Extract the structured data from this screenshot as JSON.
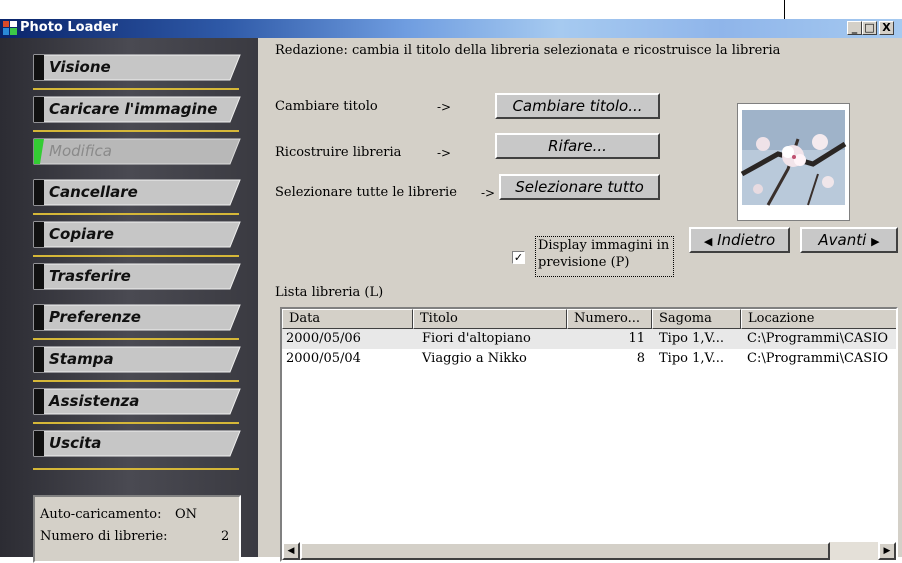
{
  "window": {
    "title": "Photo Loader"
  },
  "titlebar_buttons": {
    "minimize": "_",
    "maximize": "□",
    "close": "X"
  },
  "sidebar": {
    "items": [
      {
        "label": "Visione",
        "enabled": true
      },
      {
        "label": "Caricare l'immagine",
        "enabled": true
      },
      {
        "label": "Modifica",
        "enabled": false,
        "active": true
      },
      {
        "label": "Cancellare",
        "enabled": true
      },
      {
        "label": "Copiare",
        "enabled": true
      },
      {
        "label": "Trasferire",
        "enabled": true
      },
      {
        "label": "Preferenze",
        "enabled": true
      },
      {
        "label": "Stampa",
        "enabled": true
      },
      {
        "label": "Assistenza",
        "enabled": true
      },
      {
        "label": "Uscita",
        "enabled": true
      }
    ],
    "status": {
      "autoload_label": "Auto-caricamento:",
      "autoload_value": "ON",
      "count_label": "Numero di librerie:",
      "count_value": "2"
    }
  },
  "main": {
    "description": "Redazione: cambia il titolo della libreria selezionata e ricostruisce la libreria",
    "actions": [
      {
        "label": "Cambiare titolo",
        "arrow": "->",
        "button": "Cambiare titolo..."
      },
      {
        "label": "Ricostruire libreria",
        "arrow": "->",
        "button": "Rifare..."
      },
      {
        "label": "Selezionare tutte le librerie",
        "arrow": "->",
        "button": "Selezionare tutto"
      }
    ],
    "preview_checkbox": {
      "label": "Display immagini in previsione (P)",
      "checked": true
    },
    "nav": {
      "back": "Indietro",
      "forward": "Avanti"
    },
    "list_label": "Lista libreria (L)",
    "columns": [
      "Data",
      "Titolo",
      "Numero...",
      "Sagoma",
      "Locazione"
    ],
    "rows": [
      [
        "2000/05/06",
        "Fiori d'altopiano",
        "11",
        "Tipo 1,V...",
        "C:\\Programmi\\CASIO"
      ],
      [
        "2000/05/04",
        "Viaggio a Nikko",
        "8",
        "Tipo 1,V...",
        "C:\\Programmi\\CASIO"
      ]
    ]
  },
  "colors": {
    "accent_divider": "#d5b738",
    "active_indicator": "#33cc33",
    "titlebar": "#0a246a"
  },
  "icons": [
    "app-icon",
    "checkmark-icon",
    "back-arrow-icon",
    "forward-arrow-icon",
    "scroll-left-icon",
    "scroll-right-icon"
  ]
}
